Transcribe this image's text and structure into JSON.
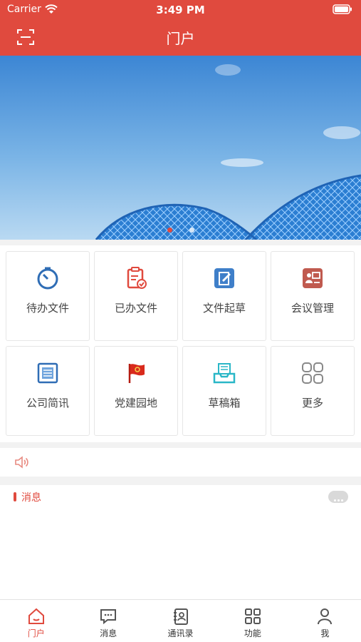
{
  "status_bar": {
    "carrier": "Carrier",
    "time": "3:49 PM"
  },
  "header": {
    "title": "门户",
    "scan_icon": "scan-icon"
  },
  "banner": {
    "slides": 2,
    "active_slide": 1
  },
  "colors": {
    "accent": "#e04a3e",
    "sky": "#5fa3e0",
    "bridge": "#2a7fd0"
  },
  "grid": {
    "items": [
      {
        "label": "待办文件",
        "icon": "timer-icon",
        "color": "#2f6db5"
      },
      {
        "label": "已办文件",
        "icon": "clipboard-check-icon",
        "color": "#e04a3e"
      },
      {
        "label": "文件起草",
        "icon": "edit-document-icon",
        "color": "#3f7fc9"
      },
      {
        "label": "会议管理",
        "icon": "meeting-icon",
        "color": "#c05a4f"
      },
      {
        "label": "公司简讯",
        "icon": "newspaper-icon",
        "color": "#2f6db5"
      },
      {
        "label": "党建园地",
        "icon": "party-flag-icon",
        "color": "#d92a1c"
      },
      {
        "label": "草稿箱",
        "icon": "inbox-tray-icon",
        "color": "#2ab7c7"
      },
      {
        "label": "更多",
        "icon": "grid-more-icon",
        "color": "#888888"
      }
    ]
  },
  "notice": {
    "icon": "speaker-icon"
  },
  "messages": {
    "title": "消息",
    "more_icon": "more-dots-icon"
  },
  "tabbar": {
    "items": [
      {
        "label": "门户",
        "icon": "home-icon",
        "active": true
      },
      {
        "label": "消息",
        "icon": "chat-icon",
        "active": false
      },
      {
        "label": "通讯录",
        "icon": "contacts-icon",
        "active": false
      },
      {
        "label": "功能",
        "icon": "apps-icon",
        "active": false
      },
      {
        "label": "我",
        "icon": "profile-icon",
        "active": false
      }
    ]
  }
}
